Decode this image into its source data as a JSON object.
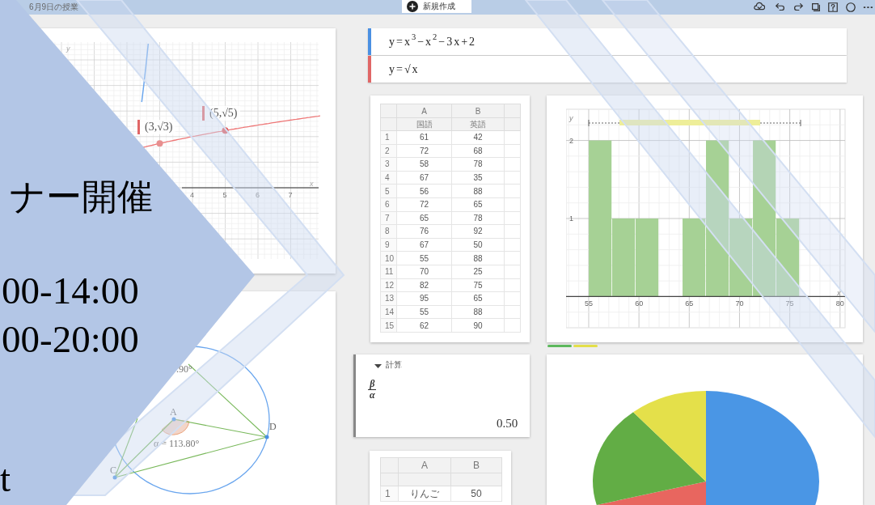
{
  "top_bar": {
    "title": "6月9日の授業",
    "new_button": "新規作成"
  },
  "algebra": [
    {
      "expression": "y=x$^{3}$−x$^{2}$−3x+2",
      "color": "#4a90e2"
    },
    {
      "expression": "y=√x",
      "color": "#e06666"
    }
  ],
  "graph": {
    "point_labels": [
      "(5,√5)",
      "(3,√3)"
    ],
    "x_ticks": [
      "4",
      "5",
      "6",
      "7"
    ],
    "x_axis_label": "x",
    "y_axis_label": "y"
  },
  "table": {
    "columns": [
      "",
      "A",
      "B"
    ],
    "subheaders": [
      "国語",
      "英語"
    ],
    "rows": [
      [
        "1",
        "61",
        "42"
      ],
      [
        "2",
        "72",
        "68"
      ],
      [
        "3",
        "58",
        "78"
      ],
      [
        "4",
        "67",
        "35"
      ],
      [
        "5",
        "56",
        "88"
      ],
      [
        "6",
        "72",
        "65"
      ],
      [
        "7",
        "65",
        "78"
      ],
      [
        "8",
        "76",
        "92"
      ],
      [
        "9",
        "67",
        "50"
      ],
      [
        "10",
        "55",
        "88"
      ],
      [
        "11",
        "70",
        "25"
      ],
      [
        "12",
        "82",
        "75"
      ],
      [
        "13",
        "95",
        "65"
      ],
      [
        "14",
        "55",
        "88"
      ],
      [
        "15",
        "62",
        "90"
      ]
    ]
  },
  "histogram": {
    "chart_data": {
      "type": "bar",
      "x": [
        56.17,
        58.5,
        60.83,
        63.17,
        65.5,
        67.83,
        70.17,
        72.5,
        74.83
      ],
      "grid": true,
      "values": [
        2,
        1,
        1,
        0,
        1,
        2,
        1,
        2,
        1
      ],
      "xlabel": "x",
      "ylabel": "y",
      "xticks": [
        55,
        60,
        65,
        70,
        75,
        80
      ],
      "yticks": [
        1,
        2
      ],
      "xlim": [
        52.75,
        80.5
      ],
      "ylim": [
        -0.4,
        2.4
      ]
    },
    "tabs": [
      {
        "color": "#5cb85c"
      },
      {
        "color": "#e3df4a"
      }
    ]
  },
  "calculation": {
    "header": "計算",
    "numerator": "β",
    "denominator": "α",
    "result": "0.50"
  },
  "geometry": {
    "angle_labels": [
      ".90°",
      "α = 113.80°"
    ],
    "point_labels": [
      "A",
      "D",
      "C"
    ]
  },
  "table_2": {
    "columns": [
      "",
      "A",
      "B"
    ],
    "rows": [
      [
        "1",
        "りんご",
        "50"
      ]
    ]
  },
  "pie_chart": {
    "slices": [
      {
        "color": "#4a96e5"
      },
      {
        "color": "#e8665f"
      },
      {
        "color": "#62ad45"
      },
      {
        "color": "#e4e04a"
      }
    ]
  },
  "overlay": {
    "texts": [
      "ナー開催",
      "00-14:00",
      "00-20:00",
      "t"
    ]
  }
}
